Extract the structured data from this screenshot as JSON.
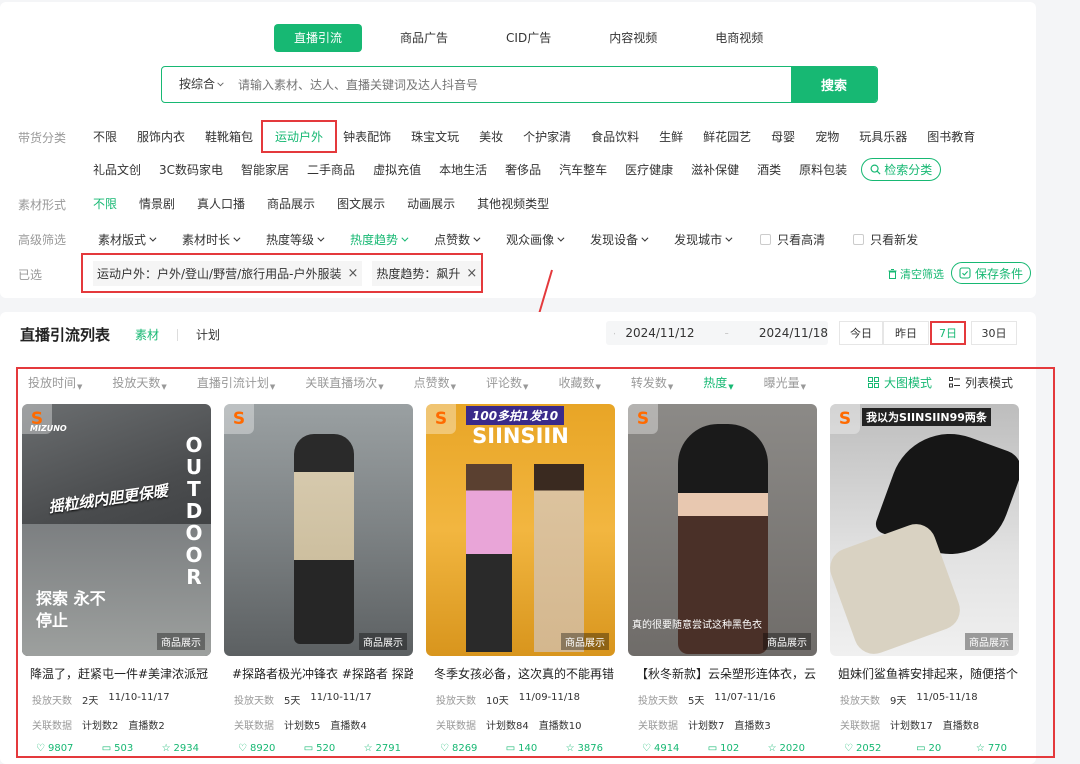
{
  "top_tabs": [
    "直播引流",
    "商品广告",
    "CID广告",
    "内容视频",
    "电商视频"
  ],
  "search": {
    "type_label": "按综合",
    "placeholder": "请输入素材、达人、直播关键词及达人抖音号",
    "button": "搜索"
  },
  "category": {
    "label": "带货分类",
    "row1": [
      "不限",
      "服饰内衣",
      "鞋靴箱包",
      "运动户外",
      "钟表配饰",
      "珠宝文玩",
      "美妆",
      "个护家清",
      "食品饮料",
      "生鲜",
      "鲜花园艺",
      "母婴",
      "宠物",
      "玩具乐器",
      "图书教育"
    ],
    "row2": [
      "礼品文创",
      "3C数码家电",
      "智能家居",
      "二手商品",
      "虚拟充值",
      "本地生活",
      "奢侈品",
      "汽车整车",
      "医疗健康",
      "滋补保健",
      "酒类",
      "原料包装"
    ],
    "search_btn": "检索分类",
    "selected": "运动户外"
  },
  "format": {
    "label": "素材形式",
    "items": [
      "不限",
      "情景剧",
      "真人口播",
      "商品展示",
      "图文展示",
      "动画展示",
      "其他视频类型"
    ]
  },
  "advanced": {
    "label": "高级筛选",
    "dropdowns": [
      "素材版式",
      "素材时长",
      "热度等级",
      "热度趋势",
      "点赞数",
      "观众画像",
      "发现设备",
      "发现城市"
    ],
    "active": "热度趋势",
    "checks": [
      "只看高清",
      "只看新发"
    ]
  },
  "selected": {
    "label": "已选",
    "tags": [
      "运动户外：户外/登山/野营/旅行用品-户外服装",
      "热度趋势：飙升"
    ],
    "clear": "清空筛选",
    "save": "保存条件"
  },
  "list": {
    "title": "直播引流列表",
    "tabs": [
      "素材",
      "计划"
    ],
    "date_start": "2024/11/12",
    "date_end": "2024/11/18",
    "periods": [
      "今日",
      "昨日",
      "7日",
      "30日"
    ],
    "active_period": "7日",
    "sorts": [
      "投放时间",
      "投放天数",
      "直播引流计划",
      "关联直播场次",
      "点赞数",
      "评论数",
      "收藏数",
      "转发数",
      "热度",
      "曝光量"
    ],
    "active_sort": "热度",
    "mode_grid": "大图模式",
    "mode_list": "列表模式"
  },
  "labels": {
    "days": "投放天数",
    "related": "关联数据",
    "plans": "计划数",
    "lives": "直播数",
    "type": "商品展示"
  },
  "cards": [
    {
      "title": "降温了，赶紧屯一件#美津浓派冠",
      "days": "2天",
      "range": "11/10-11/17",
      "plans": "计划数2",
      "lives": "直播数2",
      "likes": "9807",
      "comments": "503",
      "favs": "2934",
      "overlay_text": "摇粒绒内胆更保暖",
      "side_text": "OUTDOOR",
      "corner_text": "探索 永不停止",
      "brand": "MIZUNO"
    },
    {
      "title": "#探路者极光冲锋衣 #探路者 探路",
      "days": "5天",
      "range": "11/10-11/17",
      "plans": "计划数5",
      "lives": "直播数4",
      "likes": "8920",
      "comments": "520",
      "favs": "2791"
    },
    {
      "title": "冬季女孩必备，这次真的不能再错",
      "days": "10天",
      "range": "11/09-11/18",
      "plans": "计划数84",
      "lives": "直播数10",
      "likes": "8269",
      "comments": "140",
      "favs": "3876",
      "overlay_text": "100多拍1发10",
      "brand": "SIINSIIN"
    },
    {
      "title": "【秋冬新款】云朵塑形连体衣，云",
      "days": "5天",
      "range": "11/07-11/16",
      "plans": "计划数7",
      "lives": "直播数3",
      "likes": "4914",
      "comments": "102",
      "favs": "2020",
      "overlay_text": "真的很要随意尝试这种黑色衣"
    },
    {
      "title": "姐妹们鲨鱼裤安排起来，随便搭个",
      "days": "9天",
      "range": "11/05-11/18",
      "plans": "计划数17",
      "lives": "直播数8",
      "likes": "2052",
      "comments": "20",
      "favs": "770",
      "overlay_text": "我以为SIINSIIN99两条"
    }
  ]
}
